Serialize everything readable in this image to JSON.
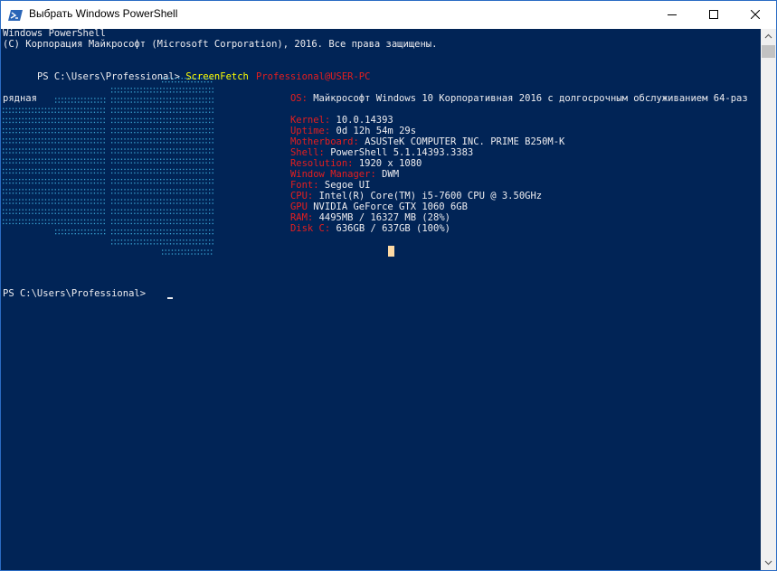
{
  "window": {
    "title": "Выбрать Windows PowerShell",
    "accent_color": "#012456"
  },
  "console": {
    "header_line1": "Windows PowerShell",
    "header_line2": "(C) Корпорация Майкрософт (Microsoft Corporation), 2016. Все права защищены.",
    "prompt1": "PS C:\\Users\\Professional> ",
    "command": "ScreenFetch",
    "os_wrap": "рядная",
    "prompt2": "PS C:\\Users\\Professional> "
  },
  "sysinfo": {
    "user_host": "Professional@USER-PC",
    "os_label": "OS:",
    "os_value": "Майкрософт Windows 10 Корпоративная 2016 с долгосрочным обслуживанием 64-раз",
    "kernel_label": "Kernel:",
    "kernel_value": "10.0.14393",
    "uptime_label": "Uptime:",
    "uptime_value": "0d 12h 54m 29s",
    "motherboard_label": "Motherboard:",
    "motherboard_value": "ASUSTeK COMPUTER INC. PRIME B250M-K",
    "shell_label": "Shell:",
    "shell_value": "PowerShell 5.1.14393.3383",
    "resolution_label": "Resolution:",
    "resolution_value": "1920 x 1080",
    "wm_label": "Window Manager:",
    "wm_value": "DWM",
    "font_label": "Font:",
    "font_value": "Segoe UI",
    "cpu_label": "CPU:",
    "cpu_value": "Intel(R) Core(TM) i5-7600 CPU @ 3.50GHz",
    "gpu_label": "GPU",
    "gpu_value": "NVIDIA GeForce GTX 1060 6GB",
    "ram_label": "RAM:",
    "ram_value": "4495MB / 16327 MB (28%)",
    "disk_label": "Disk C:",
    "disk_value": "636GB / 637GB (100%)"
  }
}
